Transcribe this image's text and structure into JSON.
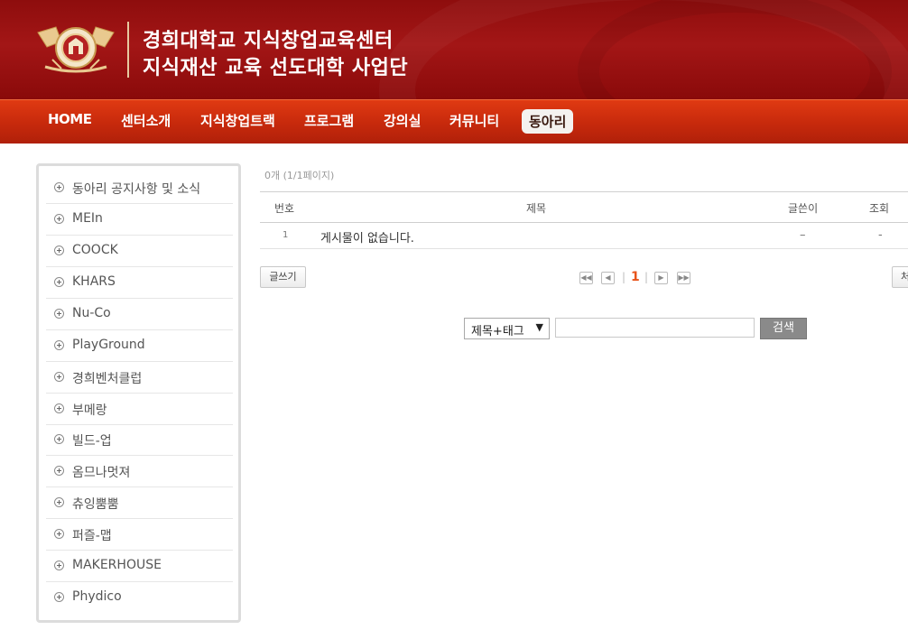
{
  "header": {
    "title_line1": "경희대학교 지식창업교육센터",
    "title_line2": "지식재산 교육 선도대학 사업단",
    "logo_icon": "university-emblem-icon"
  },
  "nav": {
    "items": [
      {
        "label": "HOME"
      },
      {
        "label": "센터소개"
      },
      {
        "label": "지식창업트랙"
      },
      {
        "label": "프로그램"
      },
      {
        "label": "강의실"
      },
      {
        "label": "커뮤니티"
      },
      {
        "label": "동아리",
        "active": true
      }
    ]
  },
  "sidebar": {
    "items": [
      {
        "label": "동아리 공지사항 및 소식"
      },
      {
        "label": "MEIn"
      },
      {
        "label": "COOCK"
      },
      {
        "label": "KHARS"
      },
      {
        "label": "Nu-Co"
      },
      {
        "label": "PlayGround"
      },
      {
        "label": "경희벤처클럽"
      },
      {
        "label": "부메랑"
      },
      {
        "label": "빌드-업"
      },
      {
        "label": "옴므나멋져"
      },
      {
        "label": "츄잉뿜뿜"
      },
      {
        "label": "퍼즐-맵"
      },
      {
        "label": "MAKERHOUSE"
      },
      {
        "label": "Phydico"
      }
    ]
  },
  "board": {
    "count_text": "0개 (1/1페이지)",
    "columns": {
      "no": "번호",
      "title": "제목",
      "author": "글쓴이",
      "views": "조회"
    },
    "rows": [
      {
        "no": "1",
        "title": "게시물이 없습니다.",
        "author": "–",
        "views": "-"
      }
    ],
    "write_button": "글쓰기",
    "right_button": "처",
    "pagination": {
      "current": "1",
      "separator": "|"
    }
  },
  "search": {
    "select_value": "제목+태그",
    "input_value": "",
    "button_label": "검색"
  },
  "colors": {
    "header_red": "#9a1212",
    "nav_orange": "#d3300e",
    "active_page": "#e8531a"
  }
}
